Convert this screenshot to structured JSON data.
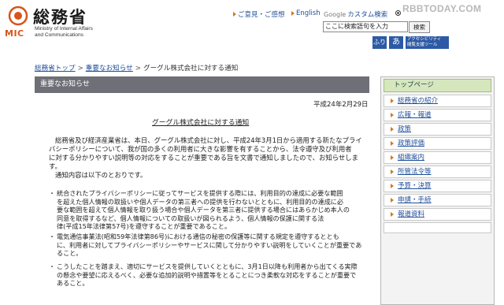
{
  "header": {
    "logo_mic": "MIC",
    "logo_title": "総務省",
    "logo_en_line1": "Ministry of Internal Affairs",
    "logo_en_line2": "and Communications",
    "links": {
      "feedback": "ご意見・ご感想",
      "english": "English",
      "google_prefix": "Google",
      "custom_search": "カスタム検索"
    },
    "search": {
      "value": "ここに検索語句を入力",
      "button": "検索"
    },
    "icons": {
      "furigana": "ふり",
      "yomi": "あ",
      "access_line1": "アクセシビリティ",
      "access_line2": "閲覧支援ツール"
    },
    "watermark": "RBBTODAY.COM"
  },
  "breadcrumb": [
    "総務省トップ",
    "重要なお知らせ",
    "グーグル株式会社に対する通知"
  ],
  "section_title": "重要なお知らせ",
  "document": {
    "date": "平成24年2月29日",
    "title": "グーグル株式会社に対する通知",
    "intro_1": "総務省及び経済産業省は、本日、グーグル株式会社に対し、平成24年3月1日から適用する新たなプライ",
    "intro_2": "バシーポリシーについて、我が国の多くの利用者に大きな影響を有することから、法令遵守及び利用者",
    "intro_3": "に対する分かりやすい説明等の対応をすることが重要である旨を文書で通知しましたので、お知らせしま",
    "intro_4": "す。",
    "intro_5": "通知内容は以下のとおりです。",
    "b1_1": "統合されたプライバシーポリシーに従ってサービスを提供する際には、利用目的の達成に必要な範囲",
    "b1_2": "を超えた個人情報の取扱いや個人データの第三者への提供を行わないとともに、利用目的の達成に必",
    "b1_3": "要な範囲を超えて個人情報を取り扱う場合や個人データを第三者に提供する場合にはあらかじめ本人の",
    "b1_4": "同意を取得するなど、個人情報についての取扱いが図られるよう、個人情報の保護に関する法",
    "b1_5": "律(平成15年法律第57号)を遵守することが重要であること。",
    "b2_1": "電気通信事業法(昭和59年法律第86号)における通信の秘密の保護等に関する規定を遵守するととも",
    "b2_2": "に、利用者に対してプライバシーポリシーやサービスに関して分かりやすい説明をしていくことが重要であ",
    "b2_3": "ること。",
    "b3_1": "こうしたことを踏まえ、適切にサービスを提供していくとともに、3月1日以降も利用者から出てくる実際",
    "b3_2": "の懸念や要望に応えるべく、必要な追加的説明や措置等をとることにつき柔軟な対応をすることが重要で",
    "b3_3": "あること。"
  },
  "sidebar": {
    "head": "トップページ",
    "items": [
      "総務省の紹介",
      "広報・報道",
      "政策",
      "政策評価",
      "組織案内",
      "所管法令等",
      "予算・決算",
      "申請・手続",
      "報道資料",
      "publication_placeholder"
    ]
  },
  "colors": {
    "accent_orange": "#d9541a",
    "link_blue": "#1f4e9a",
    "section_bar": "#6f6f78",
    "sidebar_head": "#d6e7be"
  }
}
